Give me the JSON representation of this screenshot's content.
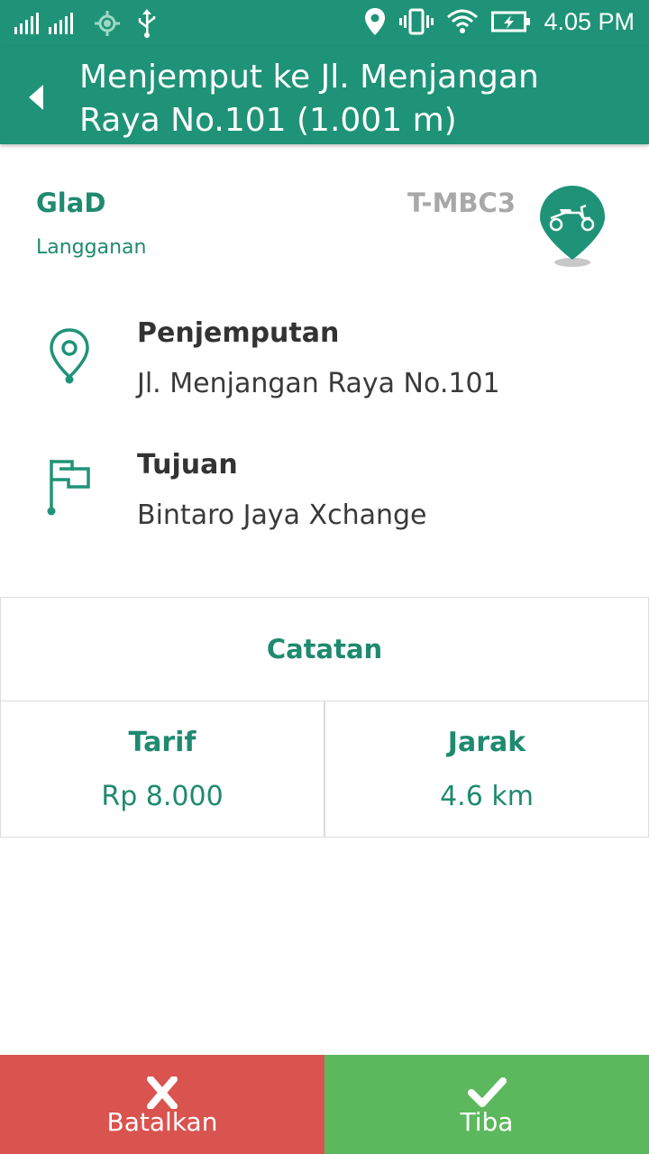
{
  "status_bar": {
    "time": "4.05 PM",
    "icons": [
      "signal-1-icon",
      "signal-2-icon",
      "gps-icon",
      "usb-icon",
      "location-icon",
      "vibrate-icon",
      "wifi-icon",
      "battery-charging-icon"
    ]
  },
  "app_bar": {
    "back_icon": "back-arrow-icon",
    "title": "Menjemput ke Jl. Menjangan Raya No.101 (1.001 m)"
  },
  "customer": {
    "name": "GlaD",
    "type": "Langganan",
    "plate": "T-MBC3",
    "vehicle_icon": "motorbike-pin-icon"
  },
  "pickup": {
    "icon": "map-pin-icon",
    "title": "Penjemputan",
    "address": "Jl. Menjangan Raya No.101"
  },
  "destination": {
    "icon": "flag-icon",
    "title": "Tujuan",
    "address": "Bintaro Jaya Xchange"
  },
  "notes": {
    "label": "Catatan"
  },
  "fare": {
    "label": "Tarif",
    "value": "Rp 8.000"
  },
  "distance": {
    "label": "Jarak",
    "value": "4.6 km"
  },
  "actions": {
    "cancel": {
      "label": "Batalkan",
      "icon": "close-icon",
      "color": "#d9534f"
    },
    "arrive": {
      "label": "Tiba",
      "icon": "check-icon",
      "color": "#5cb85c"
    }
  },
  "colors": {
    "primary": "#1f9377",
    "accent_text": "#1f8a6f"
  }
}
